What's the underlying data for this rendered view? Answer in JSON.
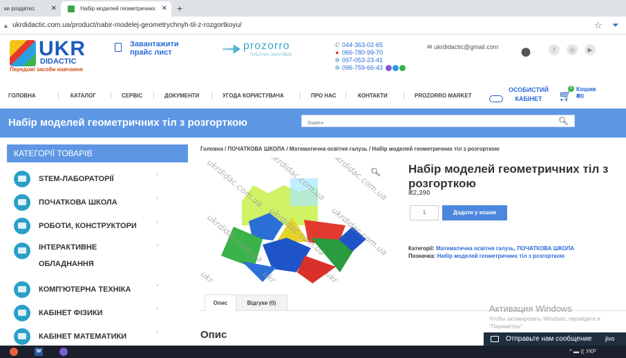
{
  "browser": {
    "tabs": [
      {
        "label": "ки роздатко:",
        "close": "✕"
      },
      {
        "label": "Набір моделей геометричних",
        "close": "✕"
      }
    ],
    "new_tab": "+",
    "url": "ukrdidactic.com.ua/product/nabir-modelej-geometrychnyh-til-z-rozgortkoyu/",
    "lock_icon": "lock-icon",
    "star_icon": "star-icon"
  },
  "header": {
    "logo": {
      "ukr": "UKR",
      "didactic": "DIDACTIC",
      "slogan": "Передові засоби навчання"
    },
    "price_list": {
      "line1": "Завантажити",
      "line2": "прайс лист"
    },
    "prozorro": {
      "word": "prozorro",
      "sub": "ПУБЛІЧНІ ЗАКУПІВЛІ"
    },
    "phones": [
      "044-363-02-65",
      "066-780-99-70",
      "097-053-23-41",
      "096-759-66-43"
    ],
    "email": "ukrdidactic@gmail.com",
    "social": [
      "f",
      "◎",
      "▶"
    ]
  },
  "nav": {
    "items": [
      "ГОЛОВНА",
      "КАТАЛОГ",
      "СЕРВІС",
      "ДОКУМЕНТИ",
      "УГОДА КОРИСТУВАЧА",
      "ПРО НАС",
      "КОНТАКТИ",
      "PROZORRO MARKET"
    ],
    "cabinet": {
      "line1": "ОСОБИСТИЙ",
      "line2": "КАБІНЕТ"
    },
    "cart": {
      "label": "Кошик",
      "amount": "₴0",
      "count": "0"
    }
  },
  "banner": {
    "title": "Набір моделей геометричних тіл з розгорткою",
    "search_placeholder": "Знайти"
  },
  "sidebar": {
    "heading": "КАТЕГОРІЇ ТОВАРІВ",
    "items": [
      {
        "label": "STEM-ЛАБОРАТОРІЇ"
      },
      {
        "label": "ПОЧАТКОВА ШКОЛА"
      },
      {
        "label": "РОБОТИ, КОНСТРУКТОРИ"
      },
      {
        "label": "ІНТЕРАКТИВНЕ",
        "label2": "ОБЛАДНАННЯ"
      },
      {
        "label": "КОМП'ЮТЕРНА ТЕХНІКА"
      },
      {
        "label": "КАБІНЕТ ФІЗИКИ"
      },
      {
        "label": "КАБІНЕТ МАТЕМАТИКИ"
      }
    ],
    "chevron": "›"
  },
  "product": {
    "breadcrumb": "Головна / ПОЧАТКОВА ШКОЛА / Математична освітня галузь / Набір моделей геометричних тіл з розгорткою",
    "name": "Набір моделей геометричних тіл з розгорткою",
    "price": "₴2,390",
    "qty": "1",
    "add_to_cart": "Додати у кошик",
    "categories_label": "Категорії:",
    "categories_value": "Математична освітня галузь, ПОЧАТКОВА ШКОЛА",
    "tag_label": "Позначка:",
    "tag_value": "Набір моделей геометричних тіл з розгорткою",
    "watermark": "ukrdidac.com.ua",
    "watermark_short": "ukr",
    "tabs": [
      "Опис",
      "Відгуки (0)"
    ],
    "desc_heading": "Опис"
  },
  "activation": {
    "title": "Активация Windows",
    "line1": "Чтобы активировать Windows, перейдите в",
    "line2": "\"Параметры\"."
  },
  "chat": {
    "label": "Отправьте нам сообщение",
    "right": "jivo"
  },
  "taskbar": {
    "word": "W",
    "tray": "^ ▬ (( УКР"
  }
}
